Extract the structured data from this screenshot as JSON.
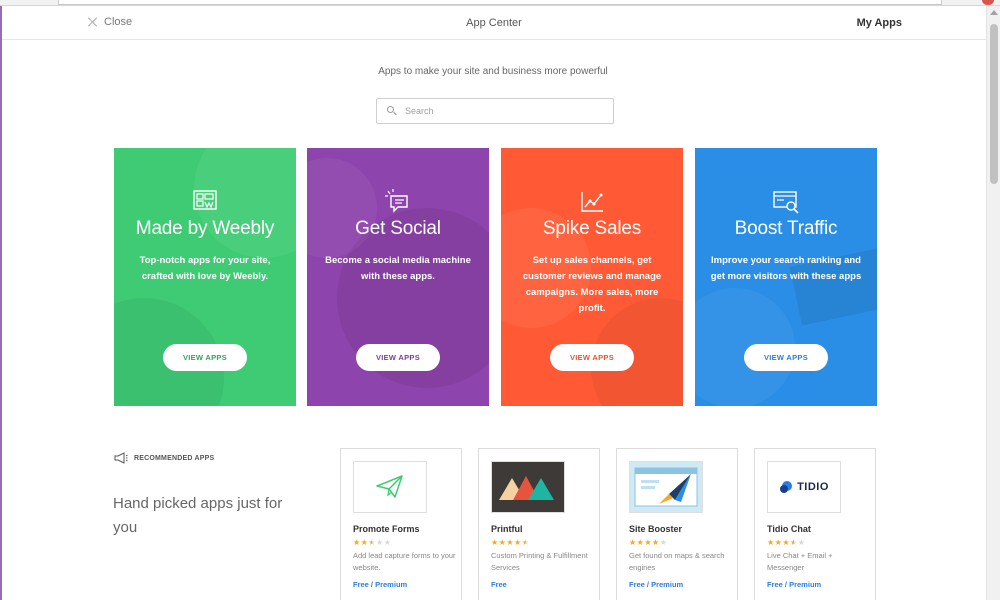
{
  "topbar": {
    "close_label": "Close",
    "title": "App Center",
    "my_apps_label": "My Apps"
  },
  "hero": {
    "subtitle": "Apps to make your site and business more powerful",
    "search_placeholder": "Search"
  },
  "categories": [
    {
      "title": "Made by Weebly",
      "description": "Top-notch apps for your site, crafted with love by Weebly.",
      "button": "VIEW APPS",
      "color": "#3ecb74",
      "icon": "weebly-apps-icon",
      "button_text_color": "#2fa35d"
    },
    {
      "title": "Get Social",
      "description": "Become a social media machine with these apps.",
      "button": "VIEW APPS",
      "color": "#8e44ad",
      "icon": "chat-bubble-icon",
      "button_text_color": "#7d3c98"
    },
    {
      "title": "Spike Sales",
      "description": "Set up sales channels, get customer reviews and manage campaigns. More sales, more profit.",
      "button": "VIEW APPS",
      "color": "#ff5a35",
      "icon": "line-chart-icon",
      "button_text_color": "#e8522f"
    },
    {
      "title": "Boost Traffic",
      "description": "Improve your search ranking and get more visitors with these apps",
      "button": "VIEW APPS",
      "color": "#2a8ee6",
      "icon": "search-window-icon",
      "button_text_color": "#2a7de1"
    }
  ],
  "recommended": {
    "header": "RECOMMENDED APPS",
    "tagline": "Hand picked apps just for you",
    "apps": [
      {
        "name": "Promote Forms",
        "rating": 2.5,
        "stars": [
          1,
          1,
          0.5,
          0,
          0
        ],
        "description": "Add lead capture forms to your website.",
        "price": "Free / Premium",
        "icon": "paper-plane-icon"
      },
      {
        "name": "Printful",
        "rating": 4.5,
        "stars": [
          1,
          1,
          1,
          1,
          0.5
        ],
        "description": "Custom Printing & Fulfillment Services",
        "price": "Free",
        "icon": "printful-logo-icon"
      },
      {
        "name": "Site Booster",
        "rating": 4,
        "stars": [
          1,
          1,
          1,
          1,
          0
        ],
        "description": "Get found on maps & search engines",
        "price": "Free / Premium",
        "icon": "rocket-icon"
      },
      {
        "name": "Tidio Chat",
        "rating": 3.5,
        "stars": [
          1,
          1,
          1,
          0.5,
          0
        ],
        "description": "Live Chat + Email + Messenger",
        "price": "Free / Premium",
        "logo_text": "TIDIO",
        "icon": "tidio-logo-icon"
      }
    ]
  }
}
